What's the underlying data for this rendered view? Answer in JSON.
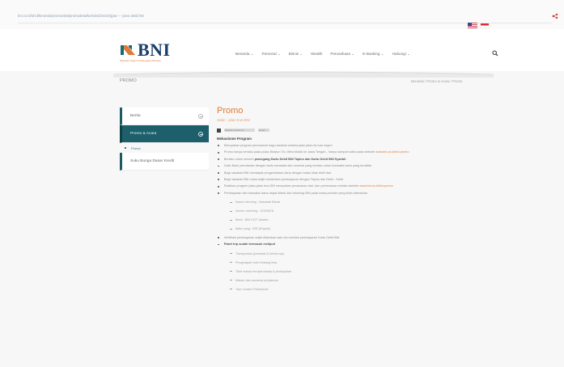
{
  "browser": {
    "url": "bni.co.id/id-id/beranda/promo/aksi/promodetail/articleid/2442/Qjaw --- juteo aksti.htm"
  },
  "header": {
    "logo_text": "BNI",
    "logo_tagline": "Melayani Negeri Kebanggaan Bangsa",
    "nav": [
      "Beranda ⌄",
      "Personal ⌄",
      "Bisnis ⌄",
      "Wealth",
      "Perusahaan ⌄",
      "E-Banking ⌄",
      "Hubungi ⌄"
    ]
  },
  "page": {
    "crumb_title": "PROMO",
    "breadcrumb": "Beranda / Promo & Acara / Promo"
  },
  "sidebar": {
    "items": [
      {
        "label": "Berita"
      },
      {
        "label": "Promo & Acara"
      }
    ],
    "sub_items": [
      {
        "label": "Promo"
      }
    ],
    "extra_item": {
      "label": "Suku Bunga Dasar Kredit"
    }
  },
  "content": {
    "title": "Promo",
    "subtitle": "Jalan - jalan trus BNI",
    "tools": [
      "Bagikan Artikel Ini",
      "Email"
    ],
    "section_heading": "Mekanisme Program",
    "bullets": [
      {
        "text": "Merupakan program pemasaran bagi nasabah selama jalan-jalan ke luar negeri"
      },
      {
        "text": "Promo hanya berlaku pada pulau Stasiun Tol, Mitra Mudik ke Jawa Tengah - hanya sampai habis pada website",
        "link": "www.bni.co.id/bni-promo"
      },
      {
        "text": "Berlaku untuk seluruh",
        "strong": "pemegang Kartu Debit BNI Taplus dan Kartu Debit BNI Syariah"
      },
      {
        "text": "Cash Back pemakaian dengan kartu transaksi dan nominal yang berlaku untuk transaksi kartu yang terdaftar"
      },
      {
        "text": "Bagi nasabah BNI mendapat pengembalian dana dengan batas tidak lebih dari"
      },
      {
        "text": "Bagi nasabah BNI maka wajib melakukan pembayaran dengan Taplus dan Debit - Debit"
      },
      {
        "text": "Pastikan program jalan-jalan trus BNI merupakan penawaran dari, dan pemesanan melalui website",
        "link": "www.bni.co.id/bni-promo"
      },
      {
        "text": "Pembayaran dan transaksi dana dapat ditarik dari rekening BNI pada masa periode yang telah ditentukan"
      }
    ],
    "dash_items": [
      "Nama rekening : Nasabah Bisnis",
      "Nomor rekening : 12345678",
      "Bank : BNI KCP Jakarta",
      "Mata uang : IDR (Rupiah)"
    ],
    "bullets2": [
      {
        "text": "Verifikasi pembayaran wajib dilakukan satu hari setelah pembayaran Kartu Debit BNI"
      },
      {
        "text": "Fasilitas yang diberikan meliputi",
        "strong": "Paket trip sudah termasuk meliputi"
      }
    ],
    "dash_items2": [
      "Transportasi (pesawat & kereta api)",
      "Penginapan hotel bintang lima",
      "Tiket masuk tempat wisata & pertunjukan",
      "Makan dan asuransi perjalanan",
      "Tour Leader Profesional"
    ]
  }
}
